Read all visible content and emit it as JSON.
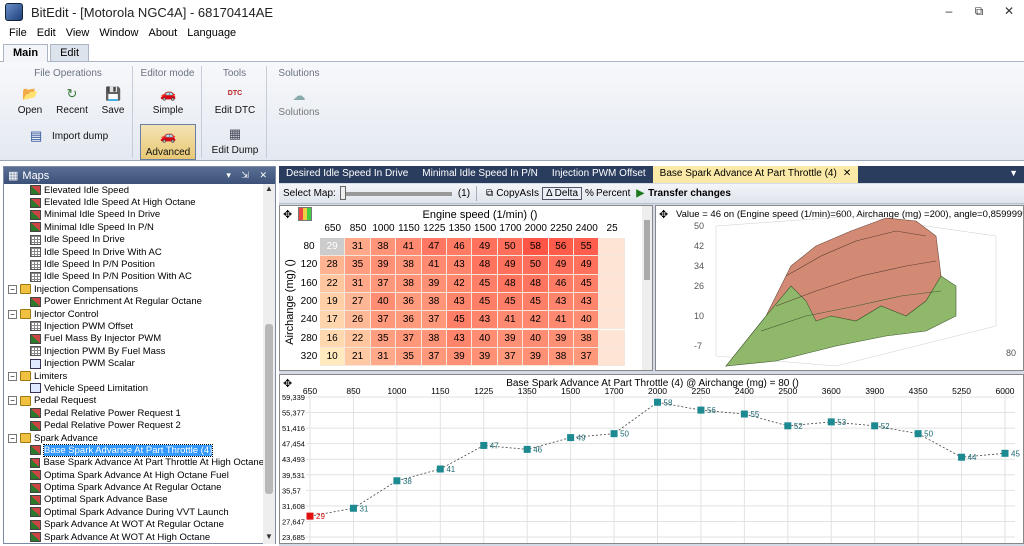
{
  "window": {
    "title": "BitEdit - [Motorola NGC4A] - 68170414AE",
    "buttons": [
      "–",
      "⧉",
      "✕"
    ]
  },
  "menu": [
    "File",
    "Edit",
    "View",
    "Window",
    "About",
    "Language"
  ],
  "ribbon_tabs": [
    "Main",
    "Edit"
  ],
  "ribbon": {
    "file_ops": {
      "title": "File Operations",
      "open": "Open",
      "recent": "Recent",
      "save": "Save",
      "import": "Import dump"
    },
    "editor_mode": {
      "title": "Editor mode",
      "simple": "Simple",
      "advanced": "Advanced"
    },
    "tools": {
      "title": "Tools",
      "edit_dtc": "Edit DTC",
      "edit_dump": "Edit Dump",
      "dtc_icon_text": "DTC"
    },
    "solutions": {
      "title": "Solutions",
      "solutions": "Solutions"
    }
  },
  "maps_pane": {
    "title": "Maps",
    "controls": "▾ ⇲ ✕"
  },
  "tree": [
    {
      "type": "map",
      "label": "Elevated Idle Speed",
      "indent": 2
    },
    {
      "type": "map",
      "label": "Elevated Idle Speed At High Octane",
      "indent": 2
    },
    {
      "type": "map",
      "label": "Minimal Idle Speed In Drive",
      "indent": 2
    },
    {
      "type": "map",
      "label": "Minimal Idle Speed In P/N",
      "indent": 2
    },
    {
      "type": "tbl",
      "label": "Idle Speed In Drive",
      "indent": 2
    },
    {
      "type": "tbl",
      "label": "Idle Speed In Drive With AC",
      "indent": 2
    },
    {
      "type": "tbl",
      "label": "Idle Speed In P/N Position",
      "indent": 2
    },
    {
      "type": "tbl",
      "label": "Idle Speed In P/N Position With AC",
      "indent": 2
    },
    {
      "type": "folder",
      "label": "Injection Compensations",
      "indent": 0
    },
    {
      "type": "map",
      "label": "Power Enrichment At Regular Octane",
      "indent": 2
    },
    {
      "type": "folder",
      "label": "Injector Control",
      "indent": 0
    },
    {
      "type": "tbl",
      "label": "Injection PWM Offset",
      "indent": 2
    },
    {
      "type": "map",
      "label": "Fuel Mass By Injector PWM",
      "indent": 2
    },
    {
      "type": "tbl",
      "label": "Injection PWM By Fuel Mass",
      "indent": 2
    },
    {
      "type": "val",
      "label": "Injection PWM Scalar",
      "indent": 2
    },
    {
      "type": "folder",
      "label": "Limiters",
      "indent": 0
    },
    {
      "type": "val",
      "label": "Vehicle Speed Limitation",
      "indent": 2
    },
    {
      "type": "folder",
      "label": "Pedal Request",
      "indent": 0
    },
    {
      "type": "map",
      "label": "Pedal Relative Power Request 1",
      "indent": 2
    },
    {
      "type": "map",
      "label": "Pedal Relative Power Request 2",
      "indent": 2
    },
    {
      "type": "folder",
      "label": "Spark Advance",
      "indent": 0
    },
    {
      "type": "map",
      "label": "Base Spark Advance At Part Throttle (4)",
      "indent": 2,
      "selected": true
    },
    {
      "type": "map",
      "label": "Base Spark Advance At Part Throttle At High Octane",
      "indent": 2
    },
    {
      "type": "map",
      "label": "Optima Spark Advance At High Octane Fuel",
      "indent": 2
    },
    {
      "type": "map",
      "label": "Optima Spark Advance At Regular Octane",
      "indent": 2
    },
    {
      "type": "map",
      "label": "Optimal Spark Advance Base",
      "indent": 2
    },
    {
      "type": "map",
      "label": "Optimal Spark Advance During VVT Launch",
      "indent": 2
    },
    {
      "type": "map",
      "label": "Spark Advance At WOT At Regular Octane",
      "indent": 2
    },
    {
      "type": "map",
      "label": "Spark Advance At WOT At High Octane",
      "indent": 2
    }
  ],
  "doc_tabs": [
    "Desired Idle Speed In Drive",
    "Minimal Idle Speed In P/N",
    "Injection PWM Offset",
    "Base Spark Advance At Part Throttle (4)"
  ],
  "toolbar": {
    "select_map": "Select Map:",
    "count": "(1)",
    "copy": "CopyAsIs",
    "delta": "Delta",
    "percent": "Percent",
    "transfer": "Transfer changes"
  },
  "table": {
    "xlabel": "Engine speed (1/min) ()",
    "ylabel": "Airchange (mg) ()",
    "cols": [
      "650",
      "850",
      "1000",
      "1150",
      "1225",
      "1350",
      "1500",
      "1700",
      "2000",
      "2250",
      "2400",
      "25"
    ],
    "rows": [
      "80",
      "120",
      "160",
      "200",
      "240",
      "280",
      "320"
    ],
    "values": [
      [
        "29",
        "31",
        "38",
        "41",
        "47",
        "46",
        "49",
        "50",
        "58",
        "56",
        "55",
        ""
      ],
      [
        "28",
        "35",
        "39",
        "38",
        "41",
        "43",
        "48",
        "49",
        "50",
        "49",
        "49",
        ""
      ],
      [
        "22",
        "31",
        "37",
        "38",
        "39",
        "42",
        "45",
        "48",
        "48",
        "46",
        "45",
        ""
      ],
      [
        "19",
        "27",
        "40",
        "36",
        "38",
        "43",
        "45",
        "45",
        "45",
        "43",
        "43",
        ""
      ],
      [
        "17",
        "26",
        "37",
        "36",
        "37",
        "45",
        "43",
        "41",
        "42",
        "41",
        "40",
        ""
      ],
      [
        "16",
        "22",
        "35",
        "37",
        "38",
        "43",
        "40",
        "39",
        "40",
        "39",
        "38",
        ""
      ],
      [
        "10",
        "21",
        "31",
        "35",
        "37",
        "39",
        "39",
        "37",
        "39",
        "38",
        "37",
        ""
      ]
    ]
  },
  "chart3d": {
    "readout": "Value = 46  on (Engine speed (1/min)=600, Airchange (mg) =200), angle=0,8599999",
    "z_ticks": [
      "50",
      "42",
      "34",
      "26",
      "10",
      "-7"
    ],
    "y_tick": "80"
  },
  "chart_data": {
    "type": "line",
    "title": "Base Spark Advance At Part Throttle (4) @ Airchange (mg) = 80 ()",
    "x_ticks": [
      "650",
      "850",
      "1000",
      "1150",
      "1225",
      "1350",
      "1500",
      "1700",
      "2000",
      "2250",
      "2400",
      "2500",
      "3600",
      "3900",
      "4350",
      "5250",
      "6000"
    ],
    "y_ticks": [
      "59,339",
      "55,377",
      "51,416",
      "47,454",
      "43,493",
      "39,531",
      "35,57",
      "31,608",
      "27,647",
      "23,685"
    ],
    "ylim": [
      23.685,
      59.339
    ],
    "values": [
      29,
      31,
      38,
      41,
      47,
      46,
      49,
      50,
      58,
      56,
      55,
      52,
      53,
      52,
      50,
      44,
      45
    ]
  }
}
